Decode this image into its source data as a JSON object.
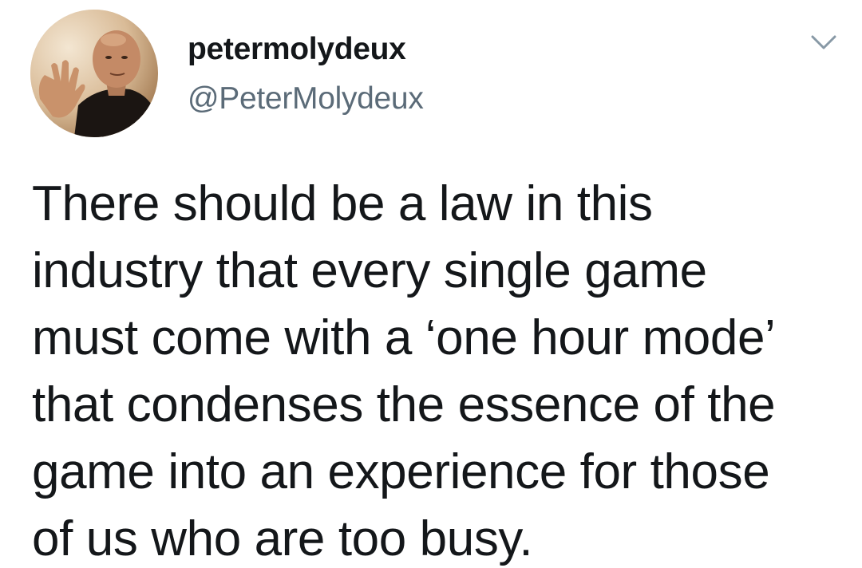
{
  "tweet": {
    "author": {
      "display_name": "petermolydeux",
      "handle": "@PeterMolydeux",
      "avatar_icon": "profile-photo"
    },
    "menu_icon": "chevron-down-icon",
    "text_lines": [
      "There should be a law in this",
      "industry that every single game",
      "must come with a ‘one hour mode’",
      "that condenses the essence of the",
      "game into an experience for those",
      "of us who are too busy."
    ]
  },
  "colors": {
    "text": "#14171a",
    "secondary": "#5b6b78",
    "background": "#ffffff"
  }
}
